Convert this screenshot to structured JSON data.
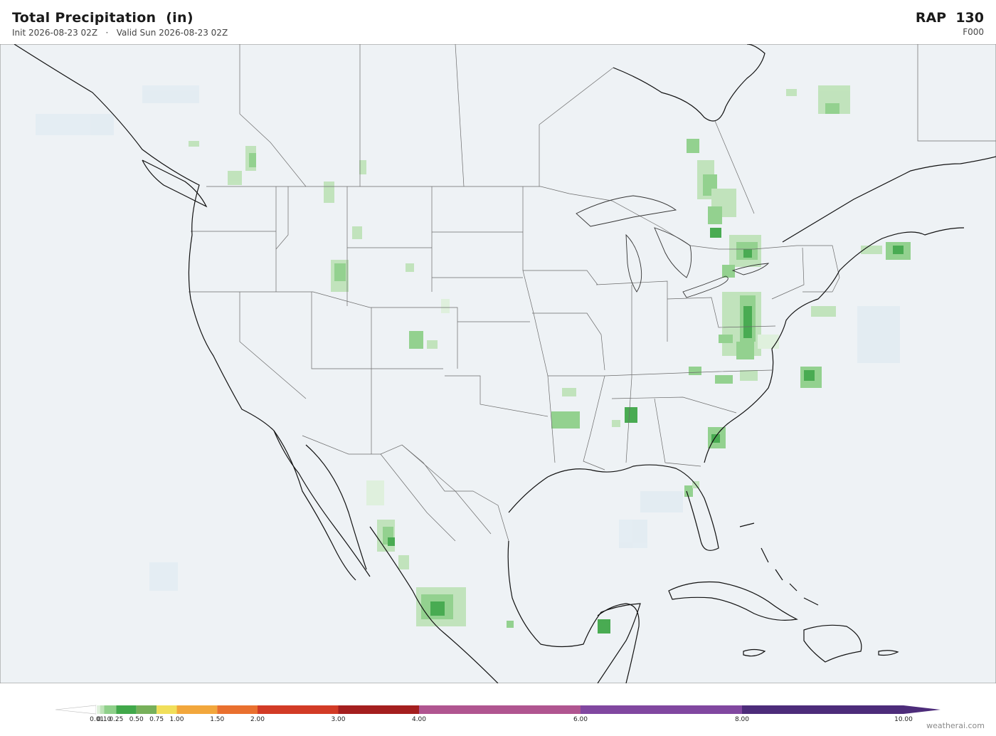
{
  "header": {
    "title": "Total Precipitation  (in)",
    "subtitle": "Init 2026-08-23 02Z   ·   Valid Sun 2026-08-23 02Z",
    "model": "RAP  130",
    "forecast_hour": "F000"
  },
  "colors": {
    "ocean": "#eef2f5",
    "land": "#eef2f5",
    "coast": "#111111",
    "borders": "#666666"
  },
  "colorbar": {
    "labels": [
      "0.01",
      "0.10",
      "0.25",
      "0.50",
      "0.75",
      "1.00",
      "1.50",
      "2.00",
      "3.00",
      "4.00",
      "6.00",
      "8.00",
      "10.00"
    ],
    "bins": [
      {
        "from": 0.0,
        "to": 0.01,
        "color": "#ffffff"
      },
      {
        "from": 0.01,
        "to": 0.05,
        "color": "#dff0dc"
      },
      {
        "from": 0.05,
        "to": 0.1,
        "color": "#bfe3b9"
      },
      {
        "from": 0.1,
        "to": 0.25,
        "color": "#8fd08a"
      },
      {
        "from": 0.25,
        "to": 0.5,
        "color": "#41a84a"
      },
      {
        "from": 0.5,
        "to": 0.75,
        "color": "#77b05a"
      },
      {
        "from": 0.75,
        "to": 1.0,
        "color": "#f1df5a"
      },
      {
        "from": 1.0,
        "to": 1.5,
        "color": "#f2a73c"
      },
      {
        "from": 1.5,
        "to": 2.0,
        "color": "#e9702f"
      },
      {
        "from": 2.0,
        "to": 3.0,
        "color": "#d23b26"
      },
      {
        "from": 3.0,
        "to": 4.0,
        "color": "#a41f1f"
      },
      {
        "from": 4.0,
        "to": 6.0,
        "color": "#b05590"
      },
      {
        "from": 6.0,
        "to": 8.0,
        "color": "#8147a0"
      },
      {
        "from": 8.0,
        "to": 10.0,
        "color": "#4d2c7a"
      }
    ],
    "under_color": "#ffffff",
    "over_color": "#4d2c7a"
  },
  "credit": "weatherai.com"
}
